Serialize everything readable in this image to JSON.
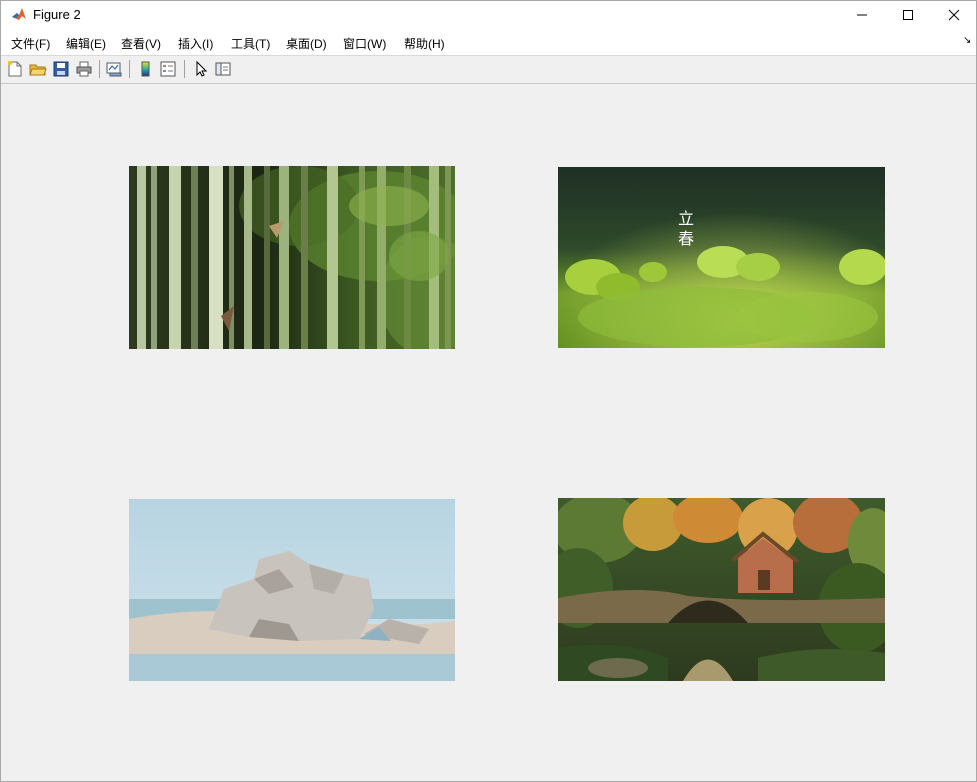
{
  "window": {
    "title": "Figure 2"
  },
  "menu": {
    "items": [
      "文件(F)",
      "编辑(E)",
      "查看(V)",
      "插入(I)",
      "工具(T)",
      "桌面(D)",
      "窗口(W)",
      "帮助(H)"
    ],
    "overflow_arrow": "↘"
  },
  "toolbar": {
    "buttons": [
      "new-figure-icon",
      "open-file-icon",
      "save-icon",
      "print-icon",
      "link-plot-icon",
      "colorbar-icon",
      "legend-icon",
      "pointer-icon",
      "property-editor-icon"
    ]
  },
  "figure": {
    "images": [
      {
        "subject": "bamboo-forest"
      },
      {
        "subject": "spring-green-sprouts",
        "caption_chars": [
          "立",
          "春"
        ]
      },
      {
        "subject": "rock-on-sand-by-water"
      },
      {
        "subject": "stone-bridge-forest-cottage"
      }
    ]
  },
  "colors": {
    "background": "#f0f0f0",
    "titlebar": "#ffffff"
  }
}
